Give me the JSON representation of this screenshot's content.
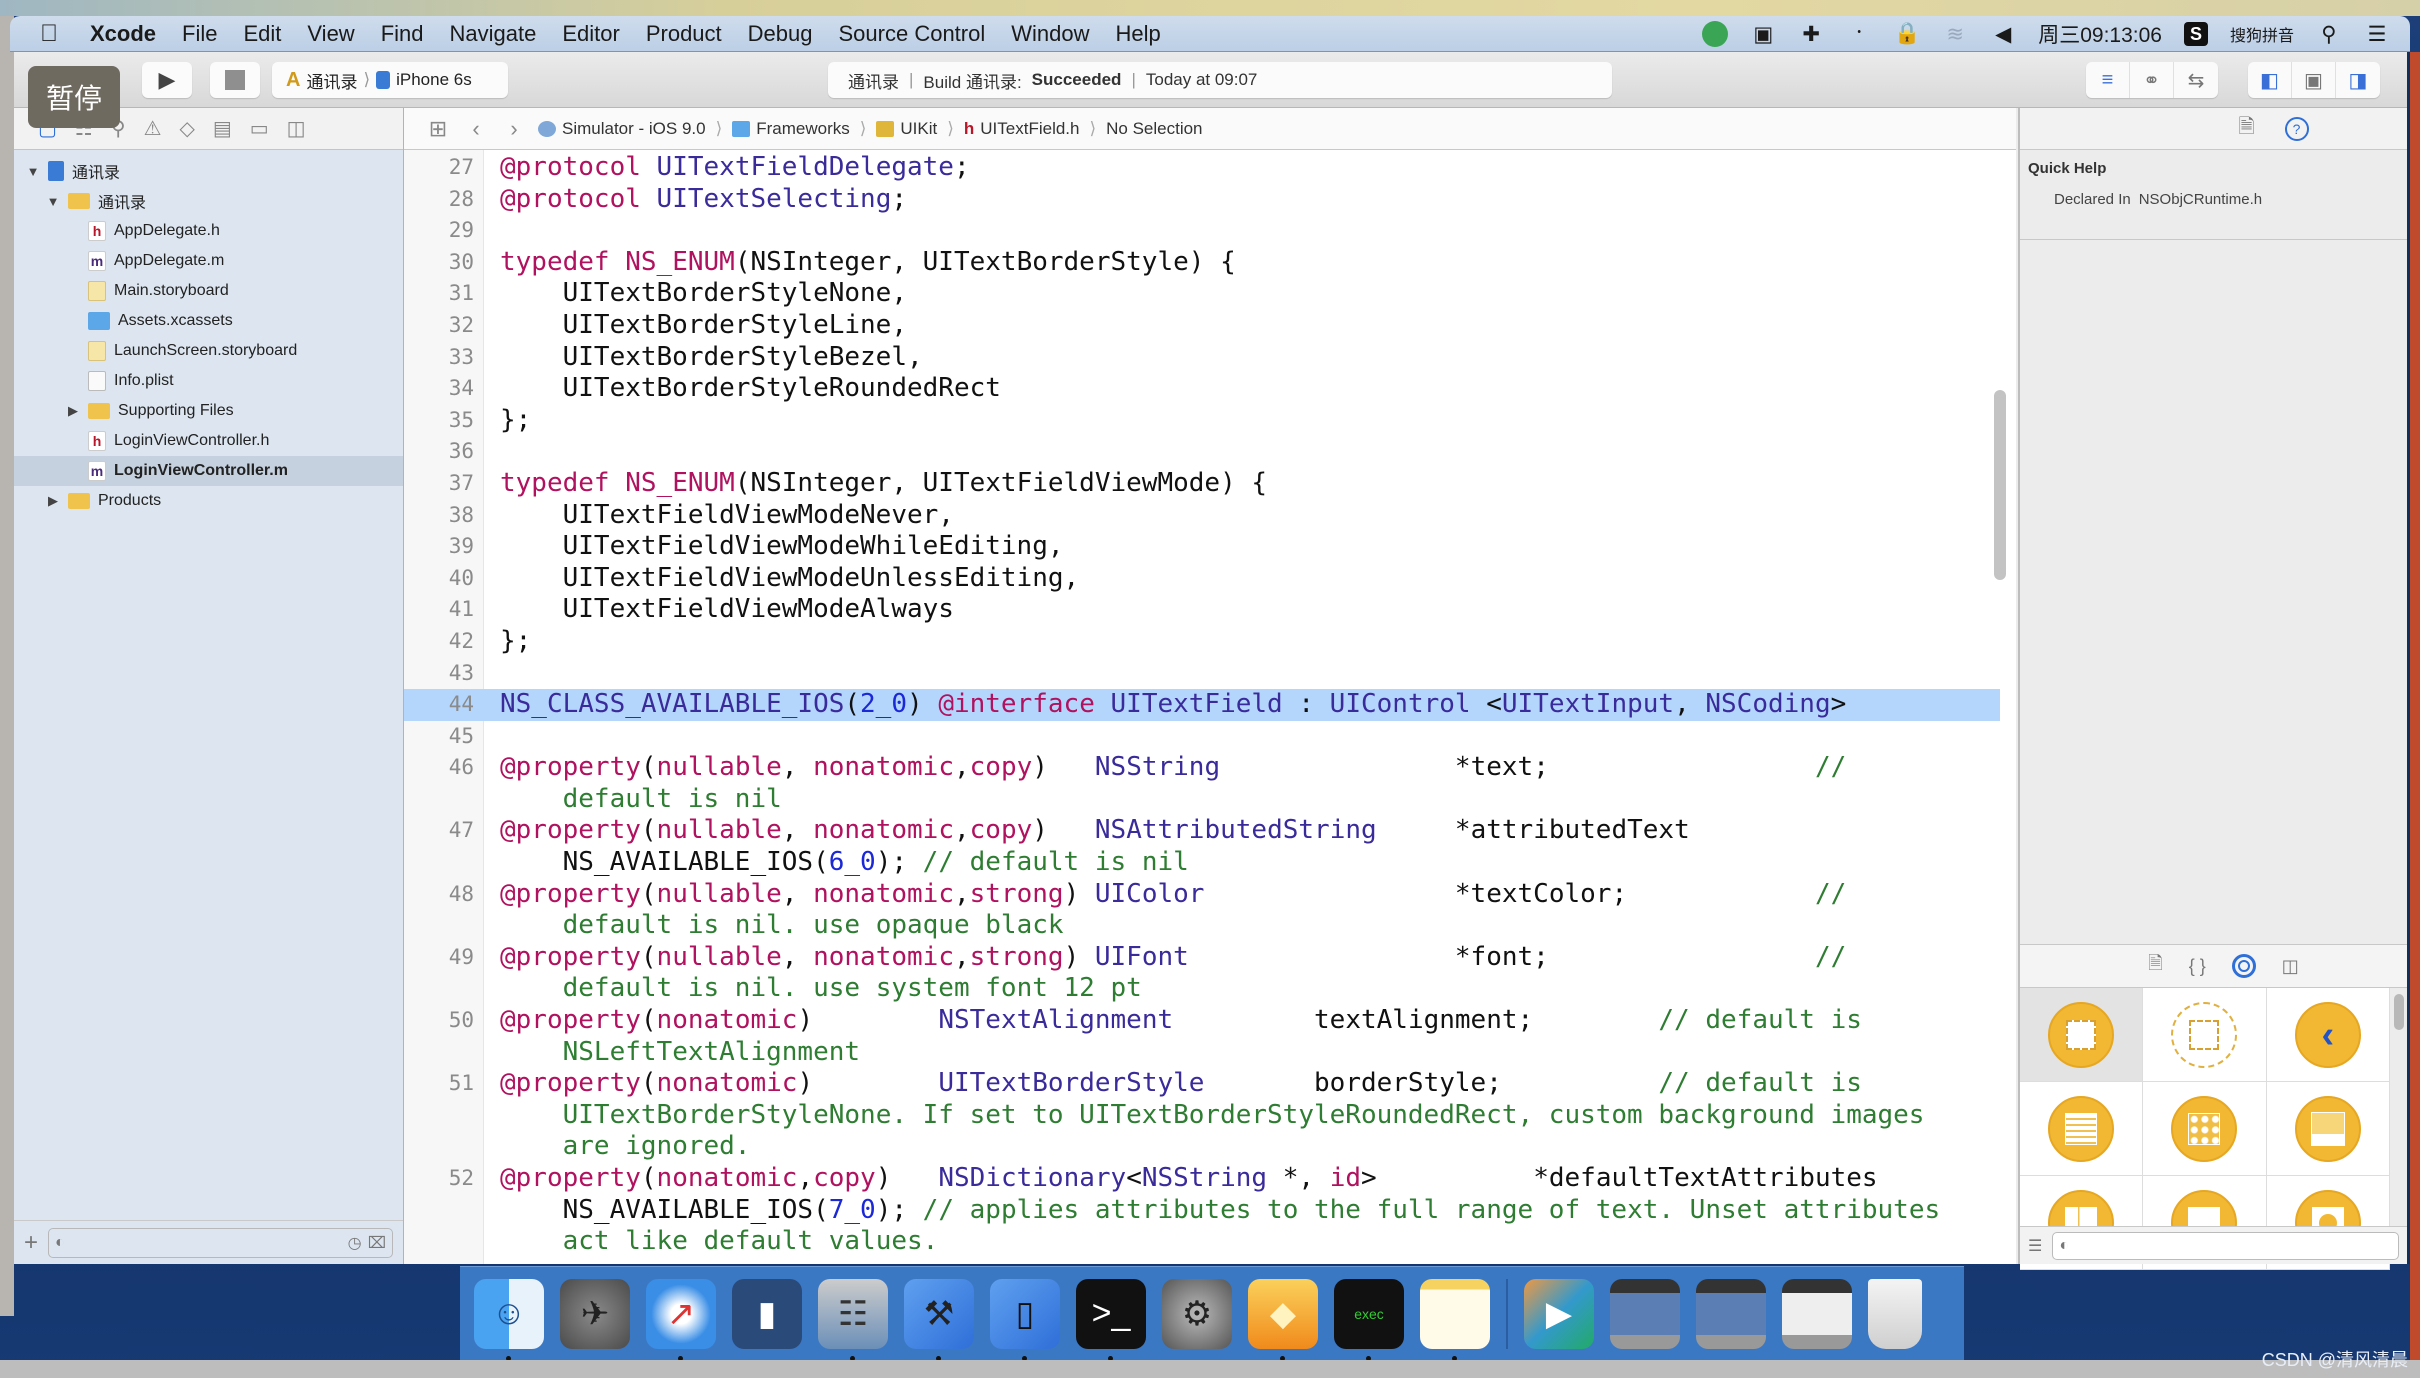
{
  "menubar": {
    "app_name": "Xcode",
    "items": [
      "File",
      "Edit",
      "View",
      "Find",
      "Navigate",
      "Editor",
      "Product",
      "Debug",
      "Source Control",
      "Window",
      "Help"
    ],
    "clock": "周三09:13:06",
    "input_method": "搜狗拼音",
    "input_method_badge": "S"
  },
  "overlay": {
    "pause_label": "暂停"
  },
  "toolbar": {
    "scheme": "通讯录",
    "device": "iPhone 6s",
    "activity_project": "通讯录",
    "activity_build_prefix": "Build 通讯录:",
    "activity_status": "Succeeded",
    "activity_time": "Today at 09:07"
  },
  "navigator": {
    "items": [
      {
        "label": "通讯录",
        "type": "project",
        "depth": 0,
        "expanded": true
      },
      {
        "label": "通讯录",
        "type": "folder",
        "depth": 1,
        "expanded": true
      },
      {
        "label": "AppDelegate.h",
        "type": "h",
        "depth": 2
      },
      {
        "label": "AppDelegate.m",
        "type": "m",
        "depth": 2
      },
      {
        "label": "Main.storyboard",
        "type": "storyboard",
        "depth": 2
      },
      {
        "label": "Assets.xcassets",
        "type": "assets",
        "depth": 2
      },
      {
        "label": "LaunchScreen.storyboard",
        "type": "storyboard",
        "depth": 2
      },
      {
        "label": "Info.plist",
        "type": "plist",
        "depth": 2
      },
      {
        "label": "Supporting Files",
        "type": "folder",
        "depth": 2,
        "expanded": false
      },
      {
        "label": "LoginViewController.h",
        "type": "h",
        "depth": 2
      },
      {
        "label": "LoginViewController.m",
        "type": "m",
        "depth": 2,
        "selected": true
      },
      {
        "label": "Products",
        "type": "folder",
        "depth": 1,
        "expanded": false
      }
    ],
    "filter_placeholder": ""
  },
  "jumpbar": {
    "crumbs": [
      "Simulator - iOS 9.0",
      "Frameworks",
      "UIKit",
      "UITextField.h",
      "No Selection"
    ]
  },
  "editor": {
    "file": "UITextField.h",
    "highlighted_line": 44,
    "lines": [
      {
        "n": "27",
        "html": "<span class='kw'>@protocol</span> <span class='ty'>UITextFieldDelegate</span>;"
      },
      {
        "n": "28",
        "html": "<span class='kw'>@protocol</span> <span class='ty'>UITextSelecting</span>;"
      },
      {
        "n": "29",
        "html": ""
      },
      {
        "n": "30",
        "html": "<span class='kw'>typedef</span> <span class='mac'>NS_ENUM</span>(NSInteger, UITextBorderStyle) {"
      },
      {
        "n": "31",
        "html": "    UITextBorderStyleNone,"
      },
      {
        "n": "32",
        "html": "    UITextBorderStyleLine,"
      },
      {
        "n": "33",
        "html": "    UITextBorderStyleBezel,"
      },
      {
        "n": "34",
        "html": "    UITextBorderStyleRoundedRect"
      },
      {
        "n": "35",
        "html": "};"
      },
      {
        "n": "36",
        "html": ""
      },
      {
        "n": "37",
        "html": "<span class='kw'>typedef</span> <span class='mac'>NS_ENUM</span>(NSInteger, UITextFieldViewMode) {"
      },
      {
        "n": "38",
        "html": "    UITextFieldViewModeNever,"
      },
      {
        "n": "39",
        "html": "    UITextFieldViewModeWhileEditing,"
      },
      {
        "n": "40",
        "html": "    UITextFieldViewModeUnlessEditing,"
      },
      {
        "n": "41",
        "html": "    UITextFieldViewModeAlways"
      },
      {
        "n": "42",
        "html": "};"
      },
      {
        "n": "43",
        "html": ""
      },
      {
        "n": "44",
        "html": "<span class='ty'>NS_CLASS_AVAILABLE_IOS</span>(<span class='num'>2_0</span>) <span class='kw'>@interface</span> <span class='ty'>UITextField</span> : <span class='ty'>UIControl</span> &lt;<span class='ty'>UITextInput</span>, <span class='ty'>NSCoding</span>&gt;",
        "hl": true
      },
      {
        "n": "45",
        "html": ""
      },
      {
        "n": "46",
        "html": "<span class='kw'>@property</span>(<span class='kw'>nullable</span>, <span class='kw'>nonatomic</span>,<span class='kw'>copy</span>)   <span class='ty'>NSString</span>               *text;                 <span class='cm'>//</span>"
      },
      {
        "n": "",
        "html": "    <span class='cm'>default is nil</span>"
      },
      {
        "n": "47",
        "html": "<span class='kw'>@property</span>(<span class='kw'>nullable</span>, <span class='kw'>nonatomic</span>,<span class='kw'>copy</span>)   <span class='ty'>NSAttributedString</span>     *attributedText"
      },
      {
        "n": "",
        "html": "    NS_AVAILABLE_IOS(<span class='num'>6_0</span>); <span class='cm'>// default is nil</span>"
      },
      {
        "n": "48",
        "html": "<span class='kw'>@property</span>(<span class='kw'>nullable</span>, <span class='kw'>nonatomic</span>,<span class='kw'>strong</span>) <span class='ty'>UIColor</span>                *textColor;            <span class='cm'>//</span>"
      },
      {
        "n": "",
        "html": "    <span class='cm'>default is nil. use opaque black</span>"
      },
      {
        "n": "49",
        "html": "<span class='kw'>@property</span>(<span class='kw'>nullable</span>, <span class='kw'>nonatomic</span>,<span class='kw'>strong</span>) <span class='ty'>UIFont</span>                 *font;                 <span class='cm'>//</span>"
      },
      {
        "n": "",
        "html": "    <span class='cm'>default is nil. use system font 12 pt</span>"
      },
      {
        "n": "50",
        "html": "<span class='kw'>@property</span>(<span class='kw'>nonatomic</span>)        <span class='ty'>NSTextAlignment</span>         textAlignment;        <span class='cm'>// default is</span>"
      },
      {
        "n": "",
        "html": "    <span class='cm'>NSLeftTextAlignment</span>"
      },
      {
        "n": "51",
        "html": "<span class='kw'>@property</span>(<span class='kw'>nonatomic</span>)        <span class='ty'>UITextBorderStyle</span>       borderStyle;          <span class='cm'>// default is</span>"
      },
      {
        "n": "",
        "html": "    <span class='cm'>UITextBorderStyleNone. If set to UITextBorderStyleRoundedRect, custom background images</span>"
      },
      {
        "n": "",
        "html": "    <span class='cm'>are ignored.</span>"
      },
      {
        "n": "52",
        "html": "<span class='kw'>@property</span>(<span class='kw'>nonatomic</span>,<span class='kw'>copy</span>)   <span class='ty'>NSDictionary</span>&lt;<span class='ty'>NSString</span> *, <span class='kw'>id</span>&gt;          *defaultTextAttributes"
      },
      {
        "n": "",
        "html": "    NS_AVAILABLE_IOS(<span class='num'>7_0</span>); <span class='cm'>// applies attributes to the full range of text. Unset attributes</span>"
      },
      {
        "n": "",
        "html": "    <span class='cm'>act like default values.</span>"
      }
    ]
  },
  "inspector": {
    "title": "Quick Help",
    "declared_label": "Declared In",
    "declared_value": "NSObjCRuntime.h",
    "library_filter_placeholder": ""
  },
  "dock": {
    "items": [
      {
        "name": "finder",
        "running": true
      },
      {
        "name": "launchpad",
        "running": false
      },
      {
        "name": "safari",
        "running": true
      },
      {
        "name": "mouse-app",
        "running": false
      },
      {
        "name": "video-app",
        "running": true
      },
      {
        "name": "xcode",
        "running": true
      },
      {
        "name": "simulator",
        "running": true
      },
      {
        "name": "terminal",
        "running": true
      },
      {
        "name": "system-preferences",
        "running": false
      },
      {
        "name": "sketch",
        "running": true
      },
      {
        "name": "console",
        "running": true
      },
      {
        "name": "notes",
        "running": true
      }
    ],
    "right_items": [
      "media-player",
      "window-thumb-1",
      "window-thumb-2",
      "window-thumb-3",
      "trash"
    ]
  },
  "watermark": "CSDN @清风清晨",
  "colors": {
    "keyword": "#b0125f",
    "type": "#3a2b9a",
    "comment": "#2e7d32",
    "number": "#1b28d6",
    "highlight": "#b4d5fc",
    "accent": "#2f6fd8",
    "library_icon": "#f2b833"
  }
}
